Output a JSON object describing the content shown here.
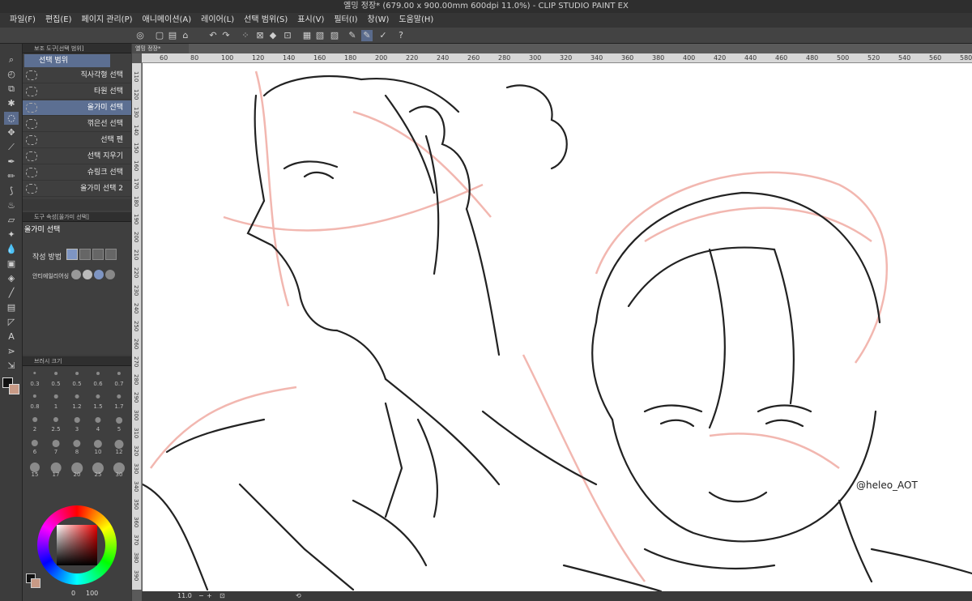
{
  "window": {
    "title": "옐밍 정장* (679.00 x 900.00mm 600dpi 11.0%)  - CLIP STUDIO PAINT EX"
  },
  "menu": [
    "파일(F)",
    "편집(E)",
    "페이지 관리(P)",
    "애니메이션(A)",
    "레이어(L)",
    "선택 범위(S)",
    "표시(V)",
    "필터(I)",
    "창(W)",
    "도움말(H)"
  ],
  "subtool_panel": {
    "header": "보조 도구[선택 범위]",
    "group": "선택 범위",
    "items": [
      "직사각형 선택",
      "타원 선택",
      "올가미 선택",
      "꺾은선 선택",
      "선택 펜",
      "선택 지우기",
      "슈링크 선택",
      "올가미 선택 2"
    ],
    "selected_index": 2
  },
  "tool_property": {
    "header": "도구 속성[올가미 선택]",
    "tool_name": "올가미 선택",
    "mode_label": "작성 방법",
    "antialias_label": "안티에일리어싱"
  },
  "brush_size": {
    "header": "브러시 크기",
    "sizes": [
      "0.3",
      "0.5",
      "0.5",
      "0.6",
      "0.7",
      "0.8",
      "1",
      "1.2",
      "1.5",
      "1.7",
      "2",
      "2.5",
      "3",
      "4",
      "5",
      "6",
      "7",
      "8",
      "10",
      "12",
      "15",
      "17",
      "20",
      "25",
      "30"
    ]
  },
  "color": {
    "main": "#111111",
    "sub": "#c89a86",
    "readout_a": "0",
    "readout_b": "100"
  },
  "canvas": {
    "tab_label": "옐밍 정장*",
    "ruler_h": [
      "60",
      "80",
      "100",
      "120",
      "140",
      "160",
      "180",
      "200",
      "220",
      "240",
      "260",
      "280",
      "300",
      "320",
      "340",
      "360",
      "380",
      "400",
      "420",
      "440",
      "460",
      "480",
      "500",
      "520",
      "540",
      "560",
      "580"
    ],
    "ruler_v": [
      "110",
      "120",
      "130",
      "140",
      "150",
      "160",
      "170",
      "180",
      "190",
      "200",
      "210",
      "220",
      "230",
      "240",
      "250",
      "260",
      "270",
      "280",
      "290",
      "300",
      "310",
      "320",
      "330",
      "340",
      "350",
      "360",
      "370",
      "380",
      "390"
    ],
    "zoom": "11.0"
  },
  "artwork": {
    "watermark": "@heleo_AOT"
  }
}
